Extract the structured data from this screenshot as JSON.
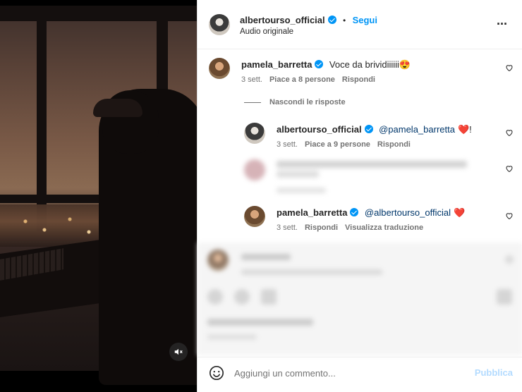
{
  "post": {
    "author": "albertourso_official",
    "follow_label": "Segui",
    "dot": "•",
    "audio": "Audio originale",
    "more_label": "···"
  },
  "comments": [
    {
      "user": "pamela_barretta",
      "text": "Voce da brividiiiiii😍",
      "time": "3 sett.",
      "likes": "Piace a 8 persone",
      "reply": "Rispondi"
    }
  ],
  "replies_toggle": "Nascondi le risposte",
  "replies": [
    {
      "user": "albertourso_official",
      "mention": "@pamela_barretta",
      "text": "❤️!",
      "time": "3 sett.",
      "likes": "Piace a 9 persone",
      "reply": "Rispondi"
    },
    {
      "user": "pamela_barretta",
      "mention": "@albertourso_official",
      "text": "❤️",
      "time": "3 sett.",
      "reply": "Rispondi",
      "translate": "Visualizza traduzione"
    }
  ],
  "composer": {
    "placeholder": "Aggiungi un commento...",
    "publish": "Pubblica"
  },
  "colors": {
    "accent": "#0095f6",
    "heart_red": "#ed4956",
    "publish_disabled": "#b3dbff"
  }
}
